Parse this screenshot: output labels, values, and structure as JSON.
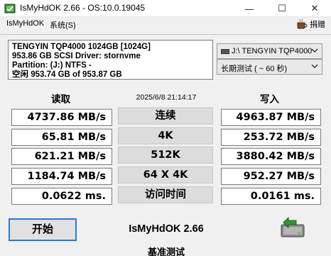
{
  "window": {
    "title": "IsMyHdOK 2.66 - OS:10.0.19045",
    "controls": {
      "minimize": "—",
      "maximize": "☐",
      "close": "✕"
    }
  },
  "menu": {
    "items": [
      {
        "label": "IsMyHdOK"
      },
      {
        "label": "系统(S)"
      }
    ],
    "donate_label": "捐赠",
    "donate_icon": "coffee-cup-icon"
  },
  "drive_info": {
    "lines": [
      "TENGYIN TQP4000 1024GB [1024G]",
      "953.86 GB  SCSI Driver: stornvme",
      "Partition: (J:) NTFS -",
      "空闲 953.74 GB of 953.87 GB"
    ]
  },
  "selectors": {
    "drive": {
      "value": "J:\\ TENGYIN TQP4000"
    },
    "test_mode": {
      "value": "长期测试 ( ~ 60 秒)"
    }
  },
  "headers": {
    "read": "读取",
    "write": "写入",
    "timestamp": "2025/6/8 21:14:17"
  },
  "rows": [
    {
      "test": "连续",
      "read": "4737.86 MB/s",
      "write": "4963.87 MB/s"
    },
    {
      "test": "4K",
      "read": "65.81 MB/s",
      "write": "253.72 MB/s"
    },
    {
      "test": "512K",
      "read": "621.21 MB/s",
      "write": "3880.42 MB/s"
    },
    {
      "test": "64 X 4K",
      "read": "1184.74 MB/s",
      "write": "952.27 MB/s"
    },
    {
      "test": "访问时间",
      "read": "0.0622 ms.",
      "write": "0.0161 ms."
    }
  ],
  "footer": {
    "start_label": "开始",
    "brand": "IsMyHdOK 2.66",
    "status": "基准测试"
  },
  "colors": {
    "accent": "#2a7ad2",
    "background": "#f0f0f0",
    "label_bg": "#dcdcdc"
  }
}
